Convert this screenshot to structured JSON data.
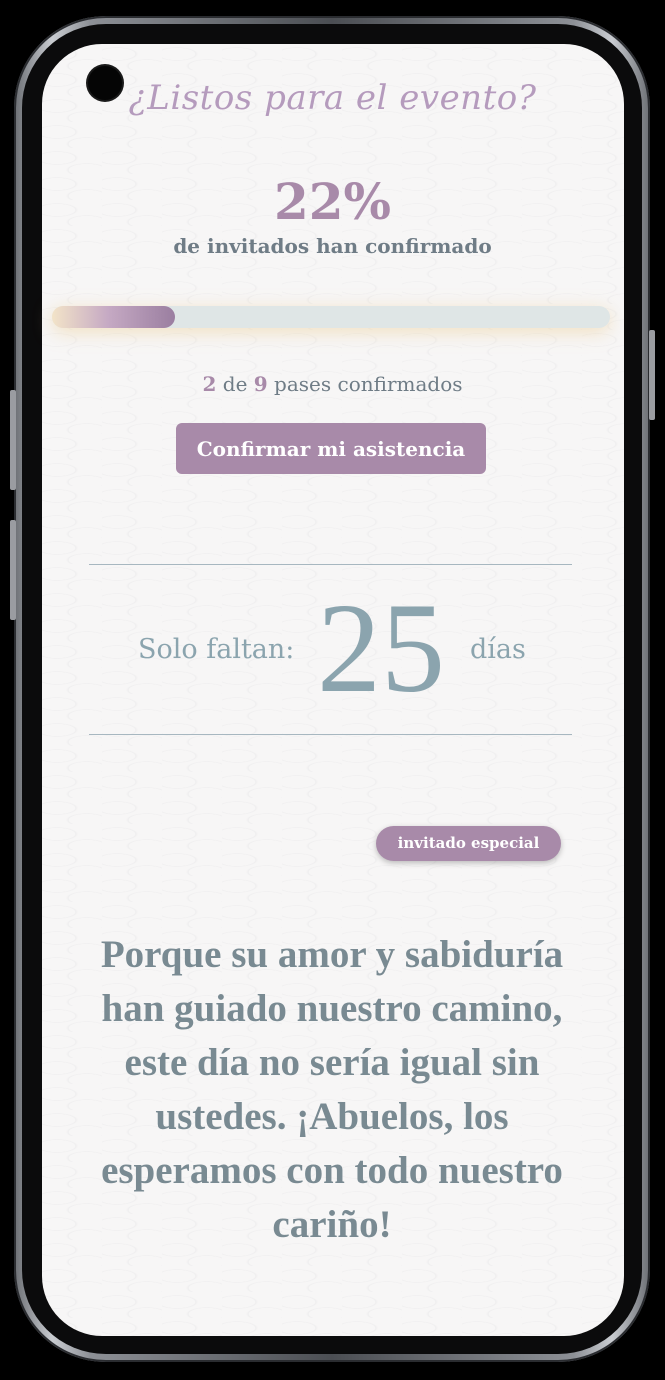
{
  "heading": "¿Listos para el evento?",
  "rsvp": {
    "percent_text": "22%",
    "percent_value": 0.22,
    "percent_label": "de invitados han confirmado",
    "confirmed": "2",
    "separator": " de ",
    "total": "9",
    "passes_suffix": " pases confirmados",
    "confirm_button": "Confirmar mi asistencia"
  },
  "countdown": {
    "label": "Solo faltan:",
    "number": "25",
    "unit": "días"
  },
  "badge": "invitado especial",
  "message": "Porque su amor y sabiduría han guiado nuestro camino, este día no sería igual sin ustedes. ¡Abuelos, los esperamos con todo nuestro cariño!",
  "colors": {
    "accent": "#a88aa9",
    "text_gray": "#6f7c86",
    "countdown": "#8ba4ae",
    "message": "#798a92",
    "track": "#dfe6e6"
  }
}
